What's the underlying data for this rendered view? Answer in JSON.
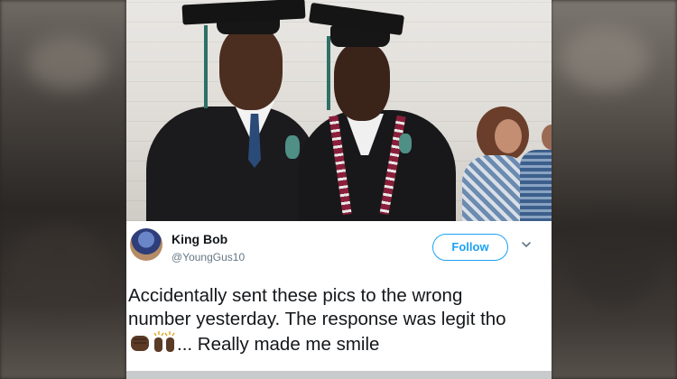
{
  "tweet": {
    "display_name": "King Bob",
    "handle": "@YoungGus10",
    "follow_label": "Follow",
    "text_line1": "Accidentally sent these pics to the wrong",
    "text_line2": "number yesterday. The response was legit tho",
    "text_line3_suffix": "... Really made me smile",
    "emojis": [
      "raised-fist-dark-skin",
      "raising-hands-dark-skin"
    ]
  },
  "colors": {
    "accent": "#1da1f2",
    "text": "#14171a",
    "muted": "#657786"
  },
  "icons": [
    "chevron-down-icon",
    "avatar"
  ]
}
